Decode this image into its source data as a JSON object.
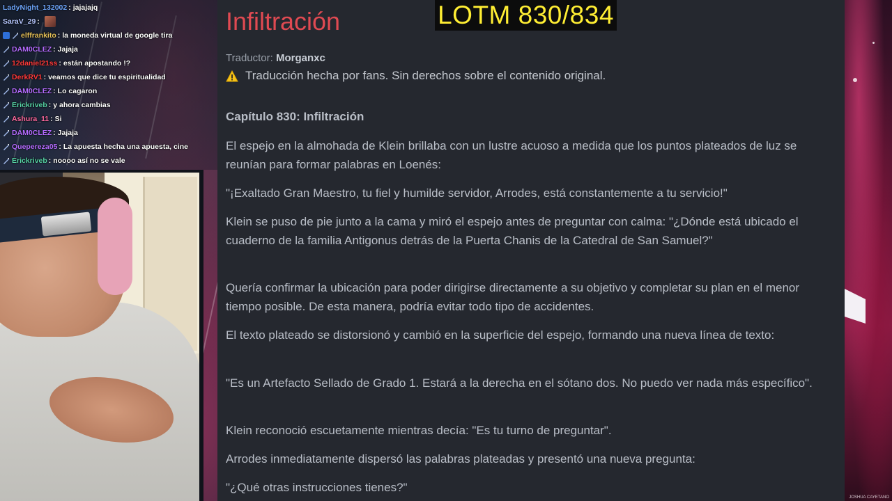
{
  "overlay": {
    "counter": "LOTM 830/834"
  },
  "chat": [
    {
      "user": "LadyNight_132002",
      "color": "#6fa8ff",
      "message": "jajajajq",
      "badge": ""
    },
    {
      "user": "SaraV_29",
      "color": "#b6c7ff",
      "message": "",
      "badge": "",
      "emote": true
    },
    {
      "user": "elffrankito",
      "color": "#e8c35a",
      "message": "la moneda virtual de google tira",
      "badge": "prime+sub"
    },
    {
      "user": "DAM0CLEZ",
      "color": "#b46cff",
      "message": "Jajaja",
      "badge": "sub"
    },
    {
      "user": "12daniel21ss",
      "color": "#ff3b3b",
      "message": "están apostando !?",
      "badge": "sub"
    },
    {
      "user": "DerkRV1",
      "color": "#ff3b3b",
      "message": "veamos que dice tu espiritualidad",
      "badge": "sub"
    },
    {
      "user": "DAM0CLEZ",
      "color": "#b46cff",
      "message": "Lo cagaron",
      "badge": "sub"
    },
    {
      "user": "Erickriveb",
      "color": "#58d6a8",
      "message": "y ahora cambias",
      "badge": "sub"
    },
    {
      "user": "Ashura_11",
      "color": "#ff6aa0",
      "message": "Si",
      "badge": "sub"
    },
    {
      "user": "DAM0CLEZ",
      "color": "#b46cff",
      "message": "Jajaja",
      "badge": "sub"
    },
    {
      "user": "Quepereza05",
      "color": "#b46cff",
      "message": "La apuesta hecha una apuesta, cine",
      "badge": "sub"
    },
    {
      "user": "Erickriveb",
      "color": "#58d6a8",
      "message": "noooo así no se vale",
      "badge": "sub"
    }
  ],
  "article": {
    "title": "Infiltración",
    "translator_label": "Traductor:",
    "translator_name": "Morganxc",
    "notice": "Traducción hecha por fans. Sin derechos sobre el contenido original.",
    "chapter": "Capítulo 830: Infiltración",
    "paragraphs": [
      "El espejo en la almohada de Klein brillaba con un lustre acuoso a medida que los puntos plateados de luz se reunían para formar palabras en Loenés:",
      "\"¡Exaltado Gran Maestro, tu fiel y humilde servidor, Arrodes, está constantemente a tu servicio!\"",
      "Klein se puso de pie junto a la cama y miró el espejo antes de preguntar con calma: \"¿Dónde está ubicado el cuaderno de la familia Antigonus detrás de la Puerta Chanis de la Catedral de San Samuel?\"",
      "Quería confirmar la ubicación para poder dirigirse directamente a su objetivo y completar su plan en el menor tiempo posible. De esta manera, podría evitar todo tipo de accidentes.",
      "El texto plateado se distorsionó y cambió en la superficie del espejo, formando una nueva línea de texto:",
      "\"Es un Artefacto Sellado de Grado 1. Estará a la derecha en el sótano dos. No puedo ver nada más específico\".",
      "Klein reconoció escuetamente mientras decía: \"Es tu turno de preguntar\".",
      "Arrodes inmediatamente dispersó las palabras plateadas y presentó una nueva pregunta:",
      "\"¿Qué otras instrucciones tienes?\""
    ]
  },
  "art_credit": "JOSHUA CAYETANO"
}
